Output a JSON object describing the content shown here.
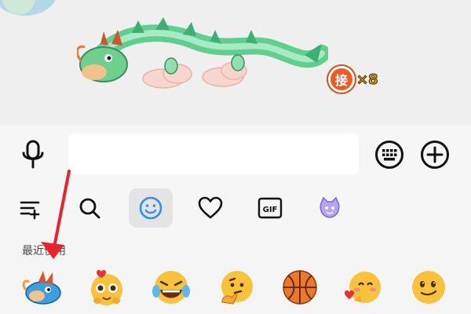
{
  "chat": {
    "badge_text": "接",
    "multiplier_text": "×8"
  },
  "input_bar": {
    "text_value": ""
  },
  "emoji_panel": {
    "tabs": [
      "list-add",
      "search",
      "emoji",
      "favorites",
      "GIF",
      "cat-stickers"
    ],
    "gif_label": "GIF",
    "active_tab": "emoji",
    "recent_label": "最近使用",
    "recent_emojis": [
      "dragon-sticker-icon",
      "heart-eyes-pleading-icon",
      "tears-of-joy-icon",
      "thinking-face-icon",
      "basketball-icon",
      "heart-kiss-icon",
      "smirk-icon"
    ]
  },
  "colors": {
    "accent_blue": "#2f8cf0",
    "badge_orange": "#f05a22",
    "annotation_red": "#e8242a"
  }
}
